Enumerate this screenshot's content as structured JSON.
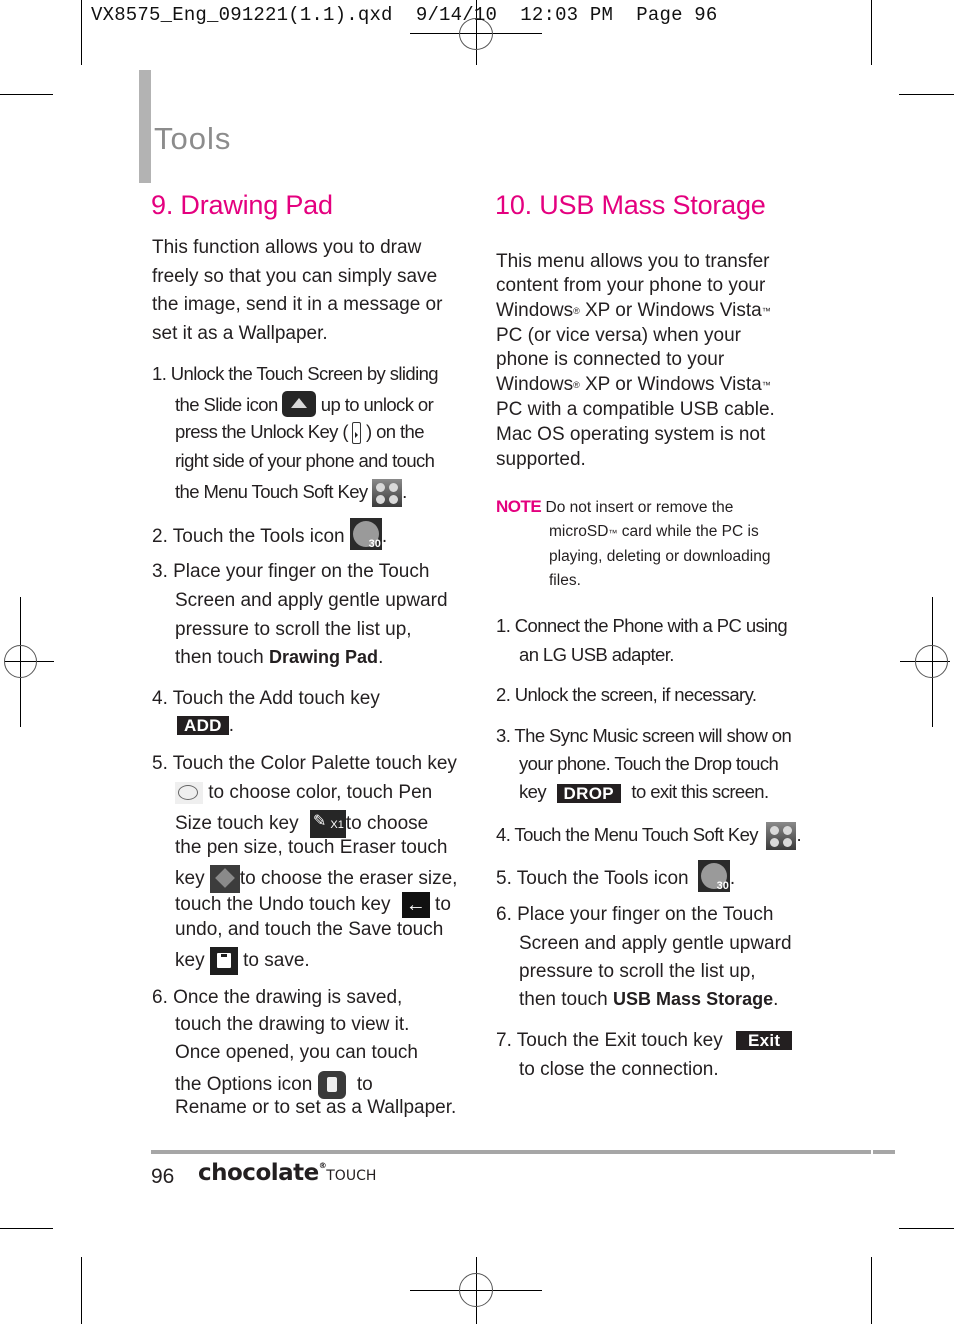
{
  "slug": "VX8575_Eng_091221(1.1).qxd  9/14/10  12:03 PM  Page 96",
  "section_title": "Tools",
  "left": {
    "heading": "9.  Drawing Pad",
    "intro": [
      "This function allows you to draw",
      "freely so that you can simply save",
      "the image, send it in a message or",
      "set it as a Wallpaper."
    ],
    "step1": {
      "l1": "1. Unlock the Touch Screen by sliding",
      "l2a": "the Slide icon",
      "l2b": "up to unlock or",
      "l3a": "press the Unlock Key (",
      "l3b": ") on the",
      "l4": "right side of your phone and touch",
      "l5": "the Menu Touch Soft Key",
      "l5end": "."
    },
    "step2": {
      "text": "2. Touch the Tools icon",
      "end": ".",
      "icon_num": "30"
    },
    "step3": {
      "l1": "3. Place your finger on the Touch",
      "l2": "Screen and apply gentle upward",
      "l3": "pressure to scroll the list up,",
      "l4a": "then touch",
      "l4b": "Drawing Pad",
      "l4c": "."
    },
    "step4": {
      "l1": "4. Touch the Add touch key",
      "key": "ADD",
      "end": "."
    },
    "step5": {
      "l1": "5. Touch the Color Palette touch key",
      "l2": "to choose color, touch Pen",
      "l3a": "Size touch key",
      "l3b": "to choose",
      "pen_label": "X1",
      "l4": "the pen size, touch Eraser touch",
      "l5a": "key",
      "l5b": "to choose the eraser size,",
      "l6a": "touch the Undo touch key",
      "l6b": "to",
      "undo_glyph": "←",
      "l7": "undo, and touch the Save touch",
      "l8a": "key",
      "l8b": "to save."
    },
    "step6": {
      "l1": "6. Once the drawing is saved,",
      "l2": "touch the drawing to view it.",
      "l3": "Once opened, you can touch",
      "l4a": "the Options icon",
      "l4b": "to",
      "l5": "Rename or to set as a Wallpaper."
    }
  },
  "right": {
    "heading": "10.  USB Mass Storage",
    "intro": {
      "l1": "This menu allows you to transfer",
      "l2": "content from your phone to your",
      "l3a": "Windows",
      "reg": "®",
      "l3b": " XP or Windows Vista",
      "tm": "™",
      "l4": "PC (or vice versa) when your",
      "l5": "phone is connected to your",
      "l6a": "Windows",
      "l6b": " XP or Windows Vista",
      "l7": "PC with a compatible USB cable.",
      "l8": "Mac OS operating system is not",
      "l9": "supported."
    },
    "note": {
      "label": "NOTE",
      "l1": "Do not insert or remove the",
      "l2a": "microSD",
      "l2b": " card while the PC is",
      "l3": "playing, deleting or downloading",
      "l4": "files."
    },
    "step1": {
      "l1": "1. Connect the Phone with a PC using",
      "l2": "an LG USB adapter."
    },
    "step2": {
      "l1": "2. Unlock the screen, if necessary."
    },
    "step3": {
      "l1": "3. The Sync Music screen will show on",
      "l2": "your phone. Touch the Drop touch",
      "l3a": "key",
      "key": "DROP",
      "l3b": "to exit this screen."
    },
    "step4": {
      "l1": "4. Touch the Menu Touch Soft Key",
      "end": "."
    },
    "step5": {
      "l1": "5. Touch the Tools icon",
      "end": ".",
      "icon_num": "30"
    },
    "step6": {
      "l1": "6. Place your finger on the Touch",
      "l2": "Screen and apply gentle upward",
      "l3": "pressure to scroll the list up,",
      "l4a": "then touch",
      "l4b": "USB Mass Storage",
      "l4c": "."
    },
    "step7": {
      "l1": "7. Touch the Exit touch key",
      "key": "Exit",
      "l2": "to close the connection."
    }
  },
  "footer": {
    "page_number": "96",
    "brand": "chocolate",
    "brand_reg": "®",
    "brand_sub": "TOUCH"
  },
  "colors": {
    "accent": "#e4007f",
    "section_gray": "#8c8c8c",
    "bar_gray": "#b3b3b3",
    "rule_gray": "#a6a6a6"
  }
}
